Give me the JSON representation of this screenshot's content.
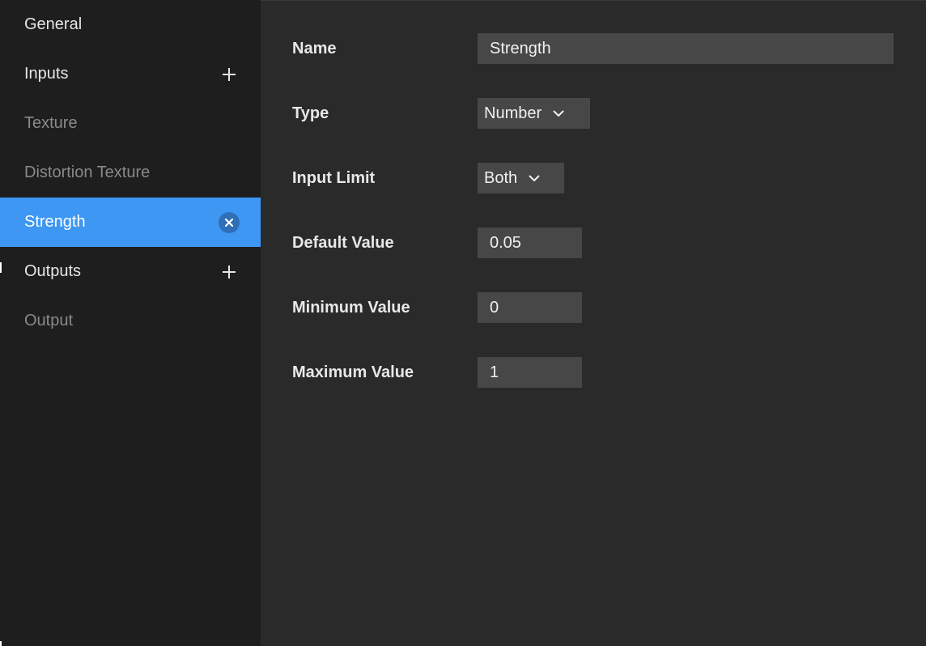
{
  "sidebar": {
    "items": [
      {
        "label": "General"
      },
      {
        "label": "Inputs",
        "action_icon": "plus-icon"
      },
      {
        "label": "Texture"
      },
      {
        "label": "Distortion Texture"
      },
      {
        "label": "Strength",
        "action_icon": "remove-icon",
        "selected": true
      },
      {
        "label": "Outputs",
        "action_icon": "plus-icon"
      },
      {
        "label": "Output"
      }
    ]
  },
  "form": {
    "name": {
      "label": "Name",
      "value": "Strength"
    },
    "type": {
      "label": "Type",
      "value": "Number"
    },
    "input_limit": {
      "label": "Input Limit",
      "value": "Both"
    },
    "default_value": {
      "label": "Default Value",
      "value": "0.05"
    },
    "minimum_value": {
      "label": "Minimum Value",
      "value": "0"
    },
    "maximum_value": {
      "label": "Maximum Value",
      "value": "1"
    }
  },
  "colors": {
    "accent": "#3d97f3",
    "sidebar_bg": "#1e1e1e",
    "panel_bg": "#2a2a2a",
    "field_bg": "#474747"
  }
}
